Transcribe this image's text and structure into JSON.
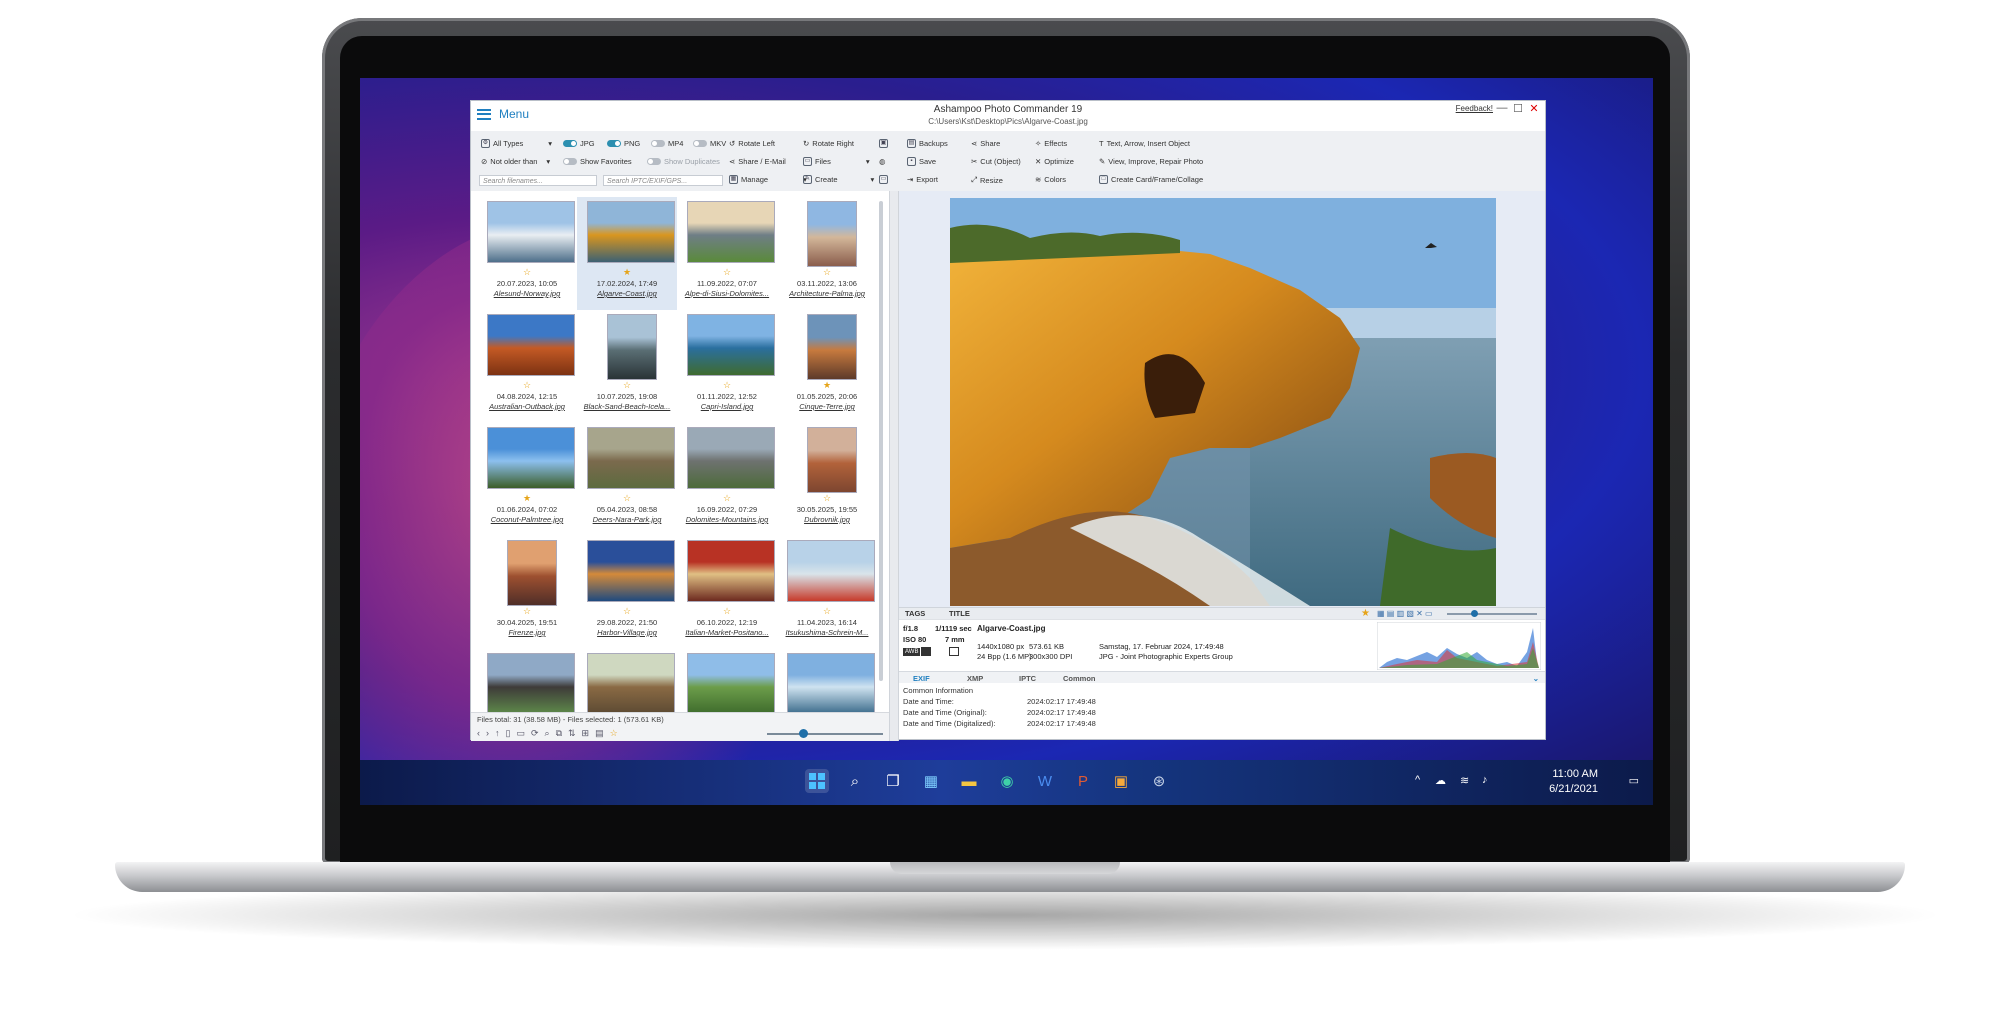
{
  "app": {
    "menu_label": "Menu",
    "title": "Ashampoo Photo Commander 19",
    "path": "C:\\Users\\Kst\\Desktop\\Pics\\Algarve-Coast.jpg",
    "feedback": "Feedback!",
    "window_controls": {
      "minimize": "—",
      "maximize": "☐",
      "close": "✕"
    }
  },
  "toolbar": {
    "filters": {
      "types": "All Types",
      "jpg": "JPG",
      "png": "PNG",
      "mp4": "MP4",
      "mkv": "MKV",
      "not_older": "Not older than",
      "show_favorites": "Show Favorites",
      "show_duplicates": "Show Duplicates",
      "search_filenames": "Search filenames...",
      "search_iptc": "Search IPTC/EXIF/GPS..."
    },
    "actions": {
      "rotate_left": "Rotate Left",
      "rotate_right": "Rotate Right",
      "share_email": "Share / E-Mail",
      "files": "Files",
      "manage": "Manage",
      "create": "Create",
      "backups": "Backups",
      "share": "Share",
      "effects": "Effects",
      "text_arrow": "Text, Arrow, Insert Object",
      "save": "Save",
      "cut_object": "Cut (Object)",
      "optimize": "Optimize",
      "view_improve": "View, Improve, Repair Photo",
      "export": "Export",
      "resize": "Resize",
      "colors": "Colors",
      "create_card": "Create Card/Frame/Collage"
    }
  },
  "thumbnails": [
    {
      "date": "20.07.2023, 10:05",
      "name": "Alesund-Norway.jpg",
      "fav": false,
      "colors": [
        "#9fc3e6",
        "#e9eef2",
        "#4e6f8a"
      ]
    },
    {
      "date": "17.02.2024, 17:49",
      "name": "Algarve-Coast.jpg",
      "fav": true,
      "selected": true,
      "colors": [
        "#8fb5d8",
        "#d9961f",
        "#3d6173"
      ]
    },
    {
      "date": "11.09.2022, 07:07",
      "name": "Alpe-di-Siusi-Dolomites...",
      "fav": false,
      "colors": [
        "#e7d6b6",
        "#6f7e86",
        "#5a8a3a"
      ]
    },
    {
      "date": "03.11.2022, 13:06",
      "name": "Architecture-Palma.jpg",
      "fav": false,
      "colors": [
        "#8fb7e2",
        "#d3b79a",
        "#8a5d4c"
      ]
    },
    {
      "date": "04.08.2024, 12:15",
      "name": "Australian-Outback.jpg",
      "fav": false,
      "colors": [
        "#3c78c6",
        "#c45a25",
        "#7c3212"
      ]
    },
    {
      "date": "10.07.2025, 19:08",
      "name": "Black-Sand-Beach-Icela...",
      "fav": false,
      "colors": [
        "#a9c2d6",
        "#5a6e74",
        "#2a3437"
      ]
    },
    {
      "date": "01.11.2022, 12:52",
      "name": "Capri-Island.jpg",
      "fav": false,
      "colors": [
        "#7fb3e3",
        "#2a6f9f",
        "#3f6b2f"
      ]
    },
    {
      "date": "01.05.2025, 20:06",
      "name": "Cinque-Terre.jpg",
      "fav": true,
      "colors": [
        "#6d93b9",
        "#c77a3e",
        "#5d3a2a"
      ]
    },
    {
      "date": "01.06.2024, 07:02",
      "name": "Coconut-Palmtree.jpg",
      "fav": true,
      "colors": [
        "#4b90d8",
        "#8cc0ef",
        "#3b5d28"
      ]
    },
    {
      "date": "05.04.2023, 08:58",
      "name": "Deers-Nara-Park.jpg",
      "fav": false,
      "colors": [
        "#a7a58c",
        "#7b6a4d",
        "#5c6b3f"
      ]
    },
    {
      "date": "16.09.2022, 07:29",
      "name": "Dolomites-Mountains.jpg",
      "fav": false,
      "colors": [
        "#9aa9b6",
        "#6e7270",
        "#4d6b3a"
      ]
    },
    {
      "date": "30.05.2025, 19:55",
      "name": "Dubrovnik.jpg",
      "fav": false,
      "colors": [
        "#d2b09a",
        "#b2623a",
        "#7d4630"
      ]
    },
    {
      "date": "30.04.2025, 19:51",
      "name": "Firenze.jpg",
      "fav": false,
      "colors": [
        "#e0a070",
        "#9d5030",
        "#4f2e28"
      ]
    },
    {
      "date": "29.08.2022, 21:50",
      "name": "Harbor-Village.jpg",
      "fav": false,
      "colors": [
        "#2a4f9a",
        "#d48a3a",
        "#1f4a7f"
      ]
    },
    {
      "date": "06.10.2022, 12:19",
      "name": "Italian-Market-Positano...",
      "fav": false,
      "colors": [
        "#b83224",
        "#e0c084",
        "#6d2a1f"
      ]
    },
    {
      "date": "11.04.2023, 16:14",
      "name": "Itsukushima-Schrein-M...",
      "fav": false,
      "colors": [
        "#b8d2e8",
        "#d9e4ea",
        "#c73a2a"
      ]
    },
    {
      "date": "",
      "name": "",
      "fav": false,
      "colors": [
        "#8fa9c6",
        "#3e3b39",
        "#5e8a4a"
      ]
    },
    {
      "date": "",
      "name": "",
      "fav": false,
      "colors": [
        "#cfd8c0",
        "#8a6a44",
        "#5c4a33"
      ]
    },
    {
      "date": "",
      "name": "",
      "fav": false,
      "colors": [
        "#8fbde8",
        "#6c9d4a",
        "#3e6b2c"
      ]
    },
    {
      "date": "",
      "name": "",
      "fav": false,
      "colors": [
        "#7fb0e0",
        "#cfe3f0",
        "#3a6a8a"
      ]
    }
  ],
  "status": {
    "files_total": "Files total: 31 (38.58 MB) - Files selected: 1 (573.61 KB)"
  },
  "tags_bar": {
    "tags": "TAGS",
    "title": "TITLE"
  },
  "info": {
    "aperture": "f/1.8",
    "shutter": "1/1119 sec",
    "iso": "ISO 80",
    "focal": "7 mm",
    "badge": "AWB",
    "filename": "Algarve-Coast.jpg",
    "dimensions": "1440x1080 px",
    "filesize": "573.61 KB",
    "date_long": "Samstag, 17. Februar 2024, 17:49:48",
    "bpp": "24 Bpp (1.6 MP)",
    "dpi": "300x300 DPI",
    "format": "JPG - Joint Photographic Experts Group"
  },
  "exif_tabs": {
    "exif": "EXIF",
    "xmp": "XMP",
    "iptc": "IPTC",
    "common": "Common"
  },
  "exif": [
    {
      "label": "Common Information",
      "value": ""
    },
    {
      "label": "Date and Time:",
      "value": "2024:02:17 17:49:48"
    },
    {
      "label": "Date and Time (Original):",
      "value": "2024:02:17 17:49:48"
    },
    {
      "label": "Date and Time (Digitalized):",
      "value": "2024:02:17 17:49:48"
    }
  ],
  "taskbar": {
    "time": "11:00 AM",
    "date": "6/21/2021",
    "icons": [
      "windows-start-icon",
      "search-icon",
      "task-view-icon",
      "widgets-icon",
      "file-explorer-icon",
      "edge-icon",
      "word-icon",
      "powerpoint-icon",
      "store-icon",
      "steam-icon"
    ]
  },
  "colors": {
    "accent": "#1f7fc0",
    "star": "#e6a419",
    "close": "#dd0000"
  }
}
